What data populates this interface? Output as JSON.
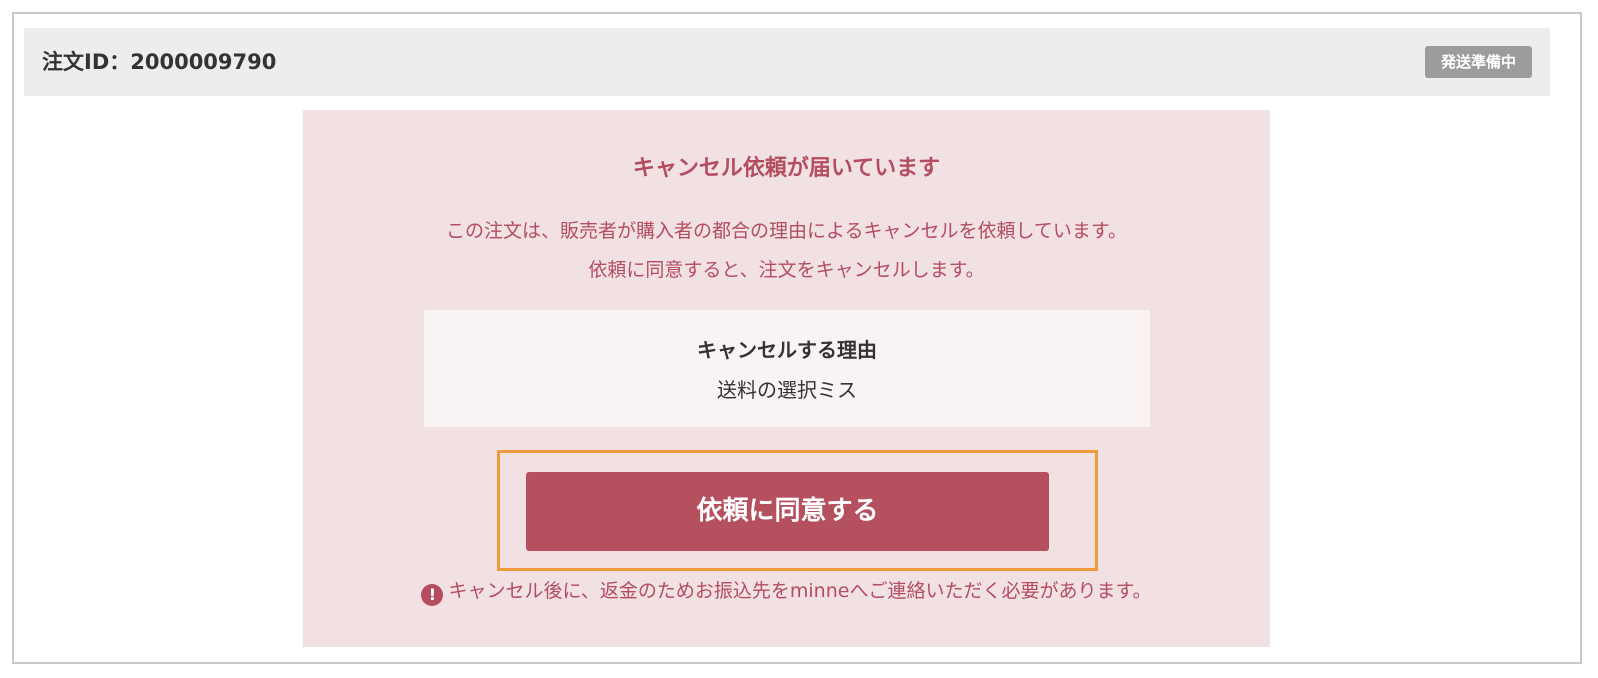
{
  "order": {
    "id_label": "注文ID：2000009790",
    "status_badge": "発送準備中"
  },
  "notice": {
    "title": "キャンセル依頼が届いています",
    "line1": "この注文は、販売者が購入者の都合の理由によるキャンセルを依頼しています。",
    "line2": "依頼に同意すると、注文をキャンセルします。",
    "reason_label": "キャンセルする理由",
    "reason_value": "送料の選択ミス",
    "agree_button": "依頼に同意する",
    "warning_icon": "!",
    "warning_text": "キャンセル後に、返金のためお振込先をminneへご連絡いただく必要があります。"
  },
  "colors": {
    "accent": "#b34d5f",
    "button": "#b5505f",
    "highlight": "#ef9a3c",
    "badge": "#9c9c9c"
  }
}
